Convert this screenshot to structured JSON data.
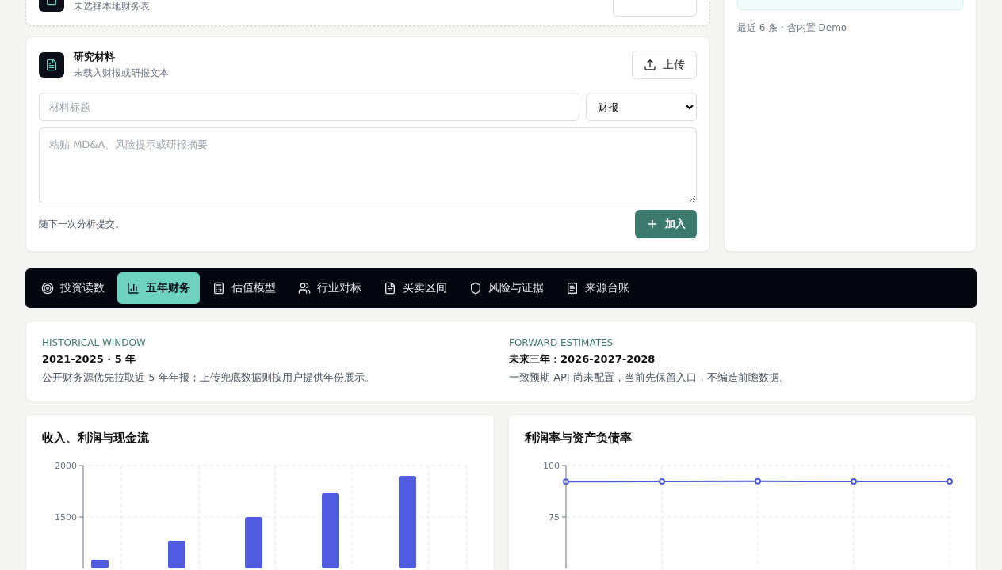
{
  "local_file_card": {
    "subtitle": "未选择本地财务表"
  },
  "research_card": {
    "title": "研究材料",
    "subtitle": "未载入财报或研报文本",
    "upload_button": "上传",
    "title_field": {
      "placeholder": "材料标题"
    },
    "type_select": {
      "value": "财报"
    },
    "content_field": {
      "placeholder": "粘贴 MD&A、风险提示或研报摘要"
    },
    "footer_note": "随下一次分析提交。",
    "add_button": "加入"
  },
  "history_panel": {
    "note": "最近 6 条 · 含内置 Demo"
  },
  "tabs": [
    {
      "label": "投资读数",
      "kind": "target",
      "selected": false
    },
    {
      "label": "五年财务",
      "kind": "chart",
      "selected": true
    },
    {
      "label": "估值模型",
      "kind": "calculator",
      "selected": false
    },
    {
      "label": "行业对标",
      "kind": "users",
      "selected": false
    },
    {
      "label": "买卖区间",
      "kind": "file",
      "selected": false
    },
    {
      "label": "风险与证据",
      "kind": "shield",
      "selected": false
    },
    {
      "label": "来源台账",
      "kind": "ledger",
      "selected": false
    }
  ],
  "windows": [
    {
      "eyebrow": "HISTORICAL WINDOW",
      "title": "2021-2025 · 5 年",
      "description": "公开财务源优先拉取近 5 年年报；上传兜底数据则按用户提供年份展示。"
    },
    {
      "eyebrow": "FORWARD ESTIMATES",
      "title": "未来三年：2026-2027-2028",
      "description": "一致预期 API 尚未配置，当前先保留入口，不编造前瞻数据。"
    }
  ],
  "charts": [
    {
      "title": "收入、利润与现金流",
      "chart_data": {
        "type": "bar",
        "values": [
          1085,
          1270,
          1500,
          1730,
          1900
        ],
        "ylim": [
          1000,
          2000
        ],
        "yticks": [
          1500,
          2000
        ],
        "grid": true
      }
    },
    {
      "title": "利润率与资产负债率",
      "chart_data": {
        "type": "line",
        "values": [
          92.2,
          92.3,
          92.4,
          92.3,
          92.3
        ],
        "ylim": [
          50,
          100
        ],
        "yticks": [
          75,
          100
        ],
        "grid": true,
        "marker": true
      }
    }
  ]
}
